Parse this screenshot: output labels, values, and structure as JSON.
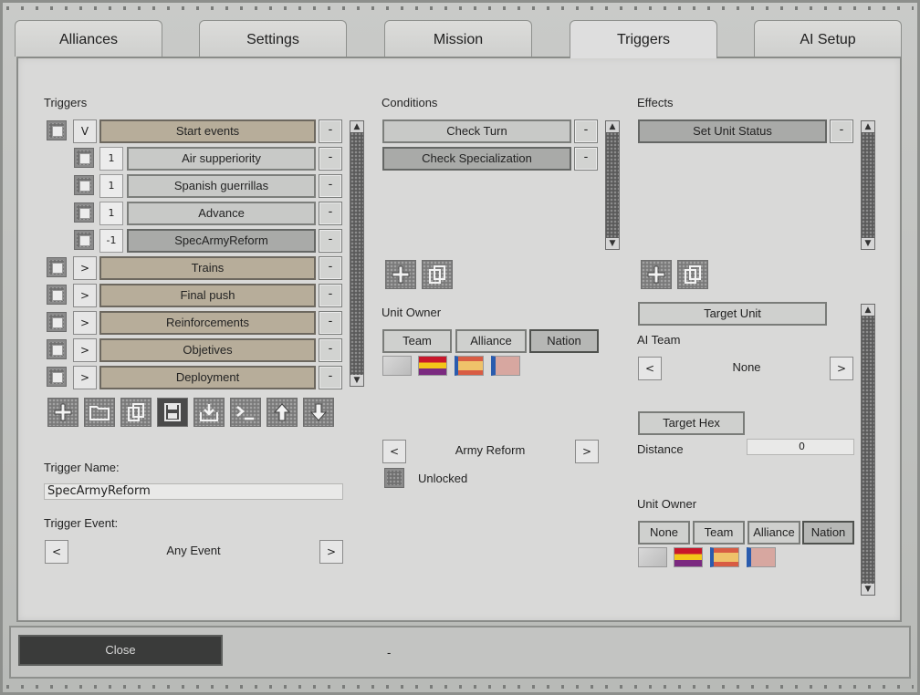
{
  "tabs": [
    {
      "label": "Alliances"
    },
    {
      "label": "Settings"
    },
    {
      "label": "Mission"
    },
    {
      "label": "Triggers"
    },
    {
      "label": "AI Setup"
    }
  ],
  "active_tab": "Triggers",
  "triggers": {
    "title": "Triggers",
    "expand_label": "V",
    "collapse_label": ">",
    "remove_label": "-",
    "rows": [
      {
        "label": "Start events",
        "toggle": "V",
        "level": 0
      },
      {
        "label": "Air supperiority",
        "count": "1",
        "level": 1
      },
      {
        "label": "Spanish guerrillas",
        "count": "1",
        "level": 1
      },
      {
        "label": "Advance",
        "count": "1",
        "level": 1
      },
      {
        "label": "SpecArmyReform",
        "count": "-1",
        "level": 1
      },
      {
        "label": "Trains",
        "toggle": ">",
        "level": 0
      },
      {
        "label": "Final push",
        "toggle": ">",
        "level": 0
      },
      {
        "label": "Reinforcements",
        "toggle": ">",
        "level": 0
      },
      {
        "label": "Objetives",
        "toggle": ">",
        "level": 0
      },
      {
        "label": "Deployment",
        "toggle": ">",
        "level": 0
      }
    ],
    "toolbar": [
      "add-icon",
      "folder-icon",
      "copy-icon",
      "save-icon",
      "import-icon",
      "console-icon",
      "arrow-up-icon",
      "arrow-down-icon"
    ],
    "name_label": "Trigger Name:",
    "name_value": "SpecArmyReform",
    "event_label": "Trigger Event:",
    "event_value": "Any Event",
    "prev": "<",
    "next": ">"
  },
  "conditions": {
    "title": "Conditions",
    "items": [
      {
        "label": "Check Turn"
      },
      {
        "label": "Check Specialization"
      }
    ],
    "unit_owner_label": "Unit Owner",
    "owner_options": [
      {
        "label": "Team"
      },
      {
        "label": "Alliance"
      },
      {
        "label": "Nation",
        "selected": true
      }
    ],
    "spec_value": "Army Reform",
    "unlocked_label": "Unlocked",
    "prev": "<",
    "next": ">"
  },
  "effects": {
    "title": "Effects",
    "items": [
      {
        "label": "Set Unit Status"
      }
    ],
    "target_unit": "Target Unit",
    "ai_team_label": "AI Team",
    "ai_team_value": "None",
    "target_hex": "Target Hex",
    "distance_label": "Distance",
    "distance_value": "0",
    "unit_owner_label": "Unit Owner",
    "owner_options": [
      {
        "label": "None"
      },
      {
        "label": "Team"
      },
      {
        "label": "Alliance"
      },
      {
        "label": "Nation",
        "selected": true
      }
    ],
    "prev": "<",
    "next": ">"
  },
  "footer": {
    "close_label": "Close",
    "dash": "-"
  }
}
